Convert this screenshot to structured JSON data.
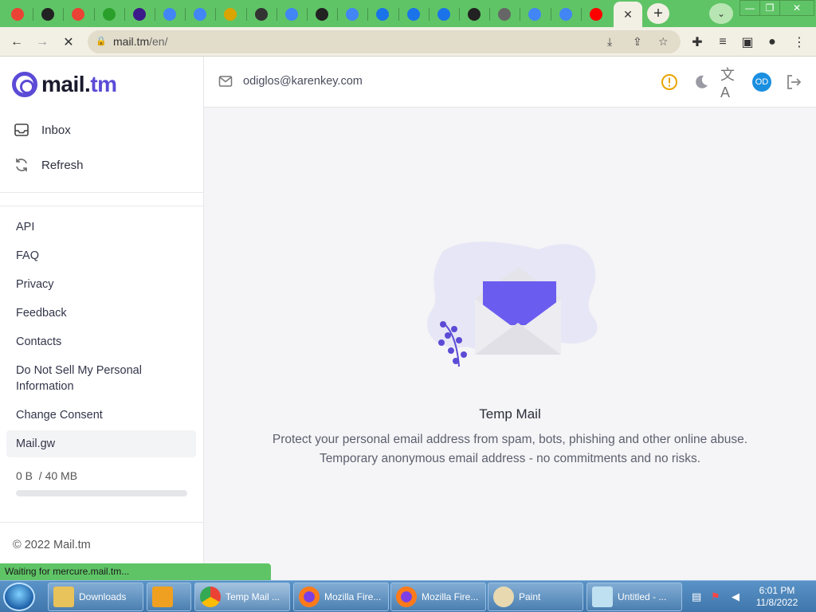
{
  "browser": {
    "tabs": [
      {
        "icon": "gmail-icon",
        "color": "#ea4335"
      },
      {
        "icon": "globe-icon",
        "color": "#222"
      },
      {
        "icon": "gmail-icon",
        "color": "#ea4335"
      },
      {
        "icon": "check-icon",
        "color": "#2aa02a"
      },
      {
        "icon": "app-icon",
        "color": "#3b1a8a"
      },
      {
        "icon": "google-icon",
        "color": "#4285f4"
      },
      {
        "icon": "google-icon",
        "color": "#4285f4"
      },
      {
        "icon": "paint-icon",
        "color": "#d9a400"
      },
      {
        "icon": "puzzle-icon",
        "color": "#333"
      },
      {
        "icon": "google-icon",
        "color": "#4285f4"
      },
      {
        "icon": "globe-icon",
        "color": "#222"
      },
      {
        "icon": "google-icon",
        "color": "#4285f4"
      },
      {
        "icon": "box-icon",
        "color": "#1a73e8"
      },
      {
        "icon": "box-icon",
        "color": "#1a73e8"
      },
      {
        "icon": "box-icon",
        "color": "#1a73e8"
      },
      {
        "icon": "globe-icon",
        "color": "#222"
      },
      {
        "icon": "chrome-icon",
        "color": "#666"
      },
      {
        "icon": "google-icon",
        "color": "#4285f4"
      },
      {
        "icon": "google-icon",
        "color": "#4285f4"
      },
      {
        "icon": "youtube-icon",
        "color": "#ff0000"
      }
    ],
    "active_tab_close": "✕",
    "new_tab_label": "+",
    "url_host": "mail.tm",
    "url_path": "/en/",
    "status_text": "Waiting for mercure.mail.tm..."
  },
  "app": {
    "logo_text_main": "mail.",
    "logo_text_accent": "tm",
    "brand_color": "#5b4bd6",
    "nav": {
      "inbox": "Inbox",
      "refresh": "Refresh"
    },
    "links": [
      "API",
      "FAQ",
      "Privacy",
      "Feedback",
      "Contacts",
      "Do Not Sell My Personal Information",
      "Change Consent",
      "Mail.gw"
    ],
    "storage": {
      "used": "0 B",
      "total": "/ 40 MB",
      "fraction": 0
    },
    "copyright": "© 2022 Mail.tm",
    "email_address": "odiglos@karenkey.com",
    "avatar_initials": "OD",
    "empty_title": "Temp Mail",
    "empty_line1": "Protect your personal email address from spam, bots, phishing and other online abuse.",
    "empty_line2": "Temporary anonymous email address - no commitments and no risks."
  },
  "taskbar": {
    "items": [
      {
        "label": "Downloads",
        "icon": "folder-icon"
      },
      {
        "label": "",
        "icon": "media-player-icon"
      },
      {
        "label": "Temp Mail ...",
        "icon": "chrome-icon"
      },
      {
        "label": "Mozilla Fire...",
        "icon": "firefox-icon"
      },
      {
        "label": "Mozilla Fire...",
        "icon": "firefox-icon"
      },
      {
        "label": "Paint",
        "icon": "paint-icon"
      },
      {
        "label": "Untitled - ...",
        "icon": "notepad-icon"
      }
    ],
    "time": "6:01 PM",
    "date": "11/8/2022"
  }
}
